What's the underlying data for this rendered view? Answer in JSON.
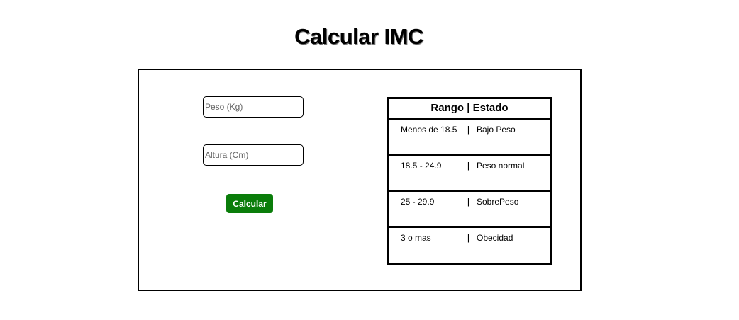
{
  "page": {
    "title": "Calcular IMC"
  },
  "form": {
    "weight_placeholder": "Peso (Kg)",
    "weight_value": "",
    "height_placeholder": "Altura (Cm)",
    "height_value": "",
    "calculate_label": "Calcular",
    "button_color": "#0a7d0a"
  },
  "ranges_table": {
    "header": "Rango | Estado",
    "separator": "|",
    "rows": [
      {
        "range": "Menos de 18.5",
        "state": "Bajo Peso"
      },
      {
        "range": "18.5 - 24.9",
        "state": "Peso normal"
      },
      {
        "range": "25 - 29.9",
        "state": "SobrePeso"
      },
      {
        "range": "3 o mas",
        "state": "Obecidad"
      }
    ]
  }
}
